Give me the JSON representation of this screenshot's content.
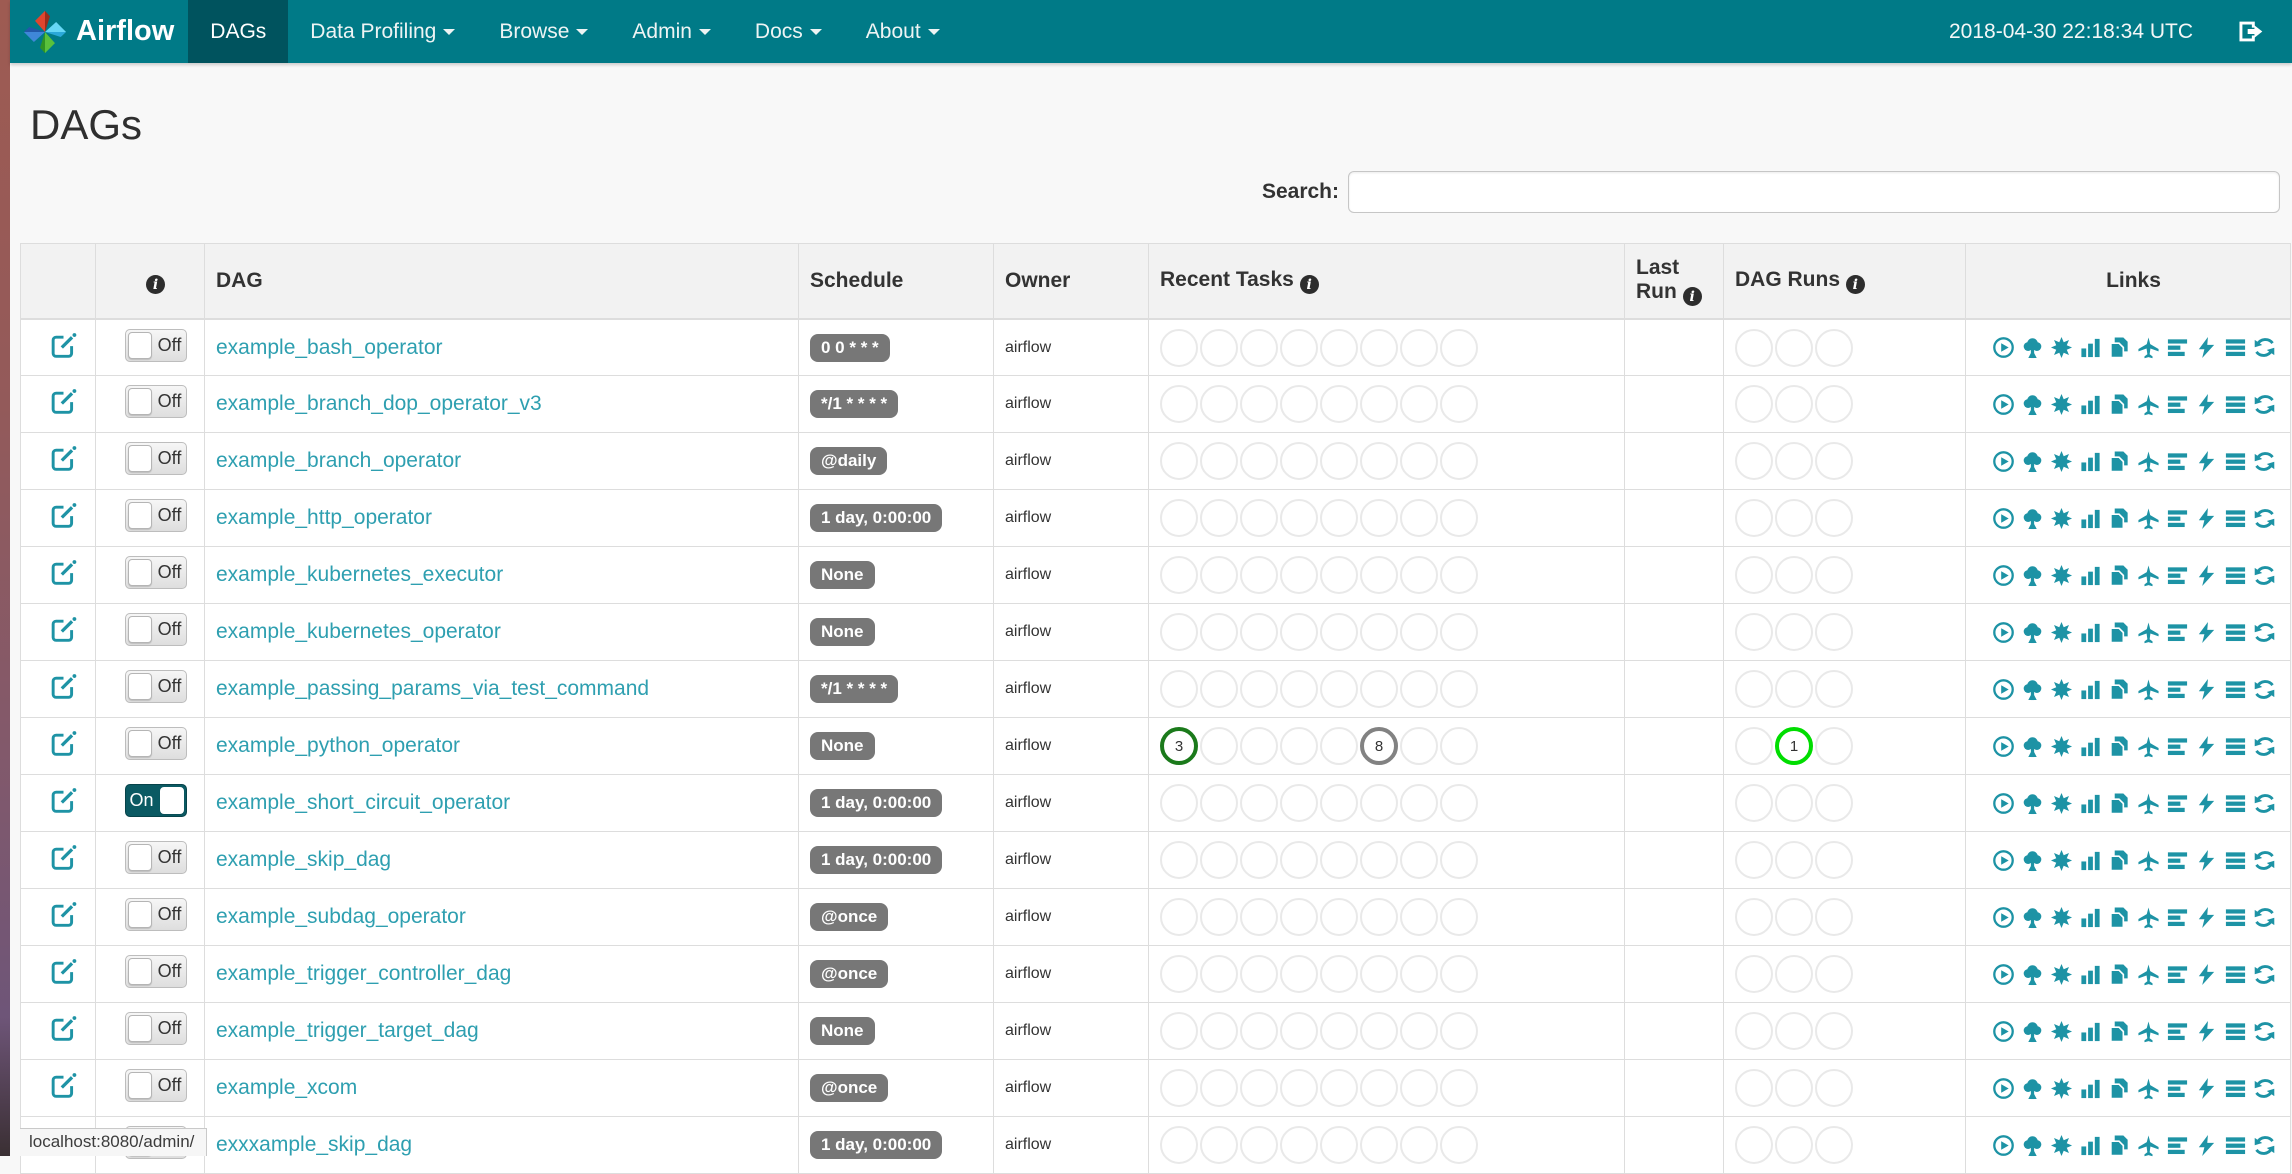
{
  "colors": {
    "navbar": "#007a87",
    "navbar_active": "#00535e",
    "link_teal": "#2e9fb0",
    "icon_teal": "#1d93a5",
    "badge_gray": "#777777",
    "ring_success_green": "#1b7a1b",
    "ring_gray": "#828282",
    "ring_running_lime": "#00dd00"
  },
  "navbar": {
    "brand": "Airflow",
    "clock": "2018-04-30 22:18:34 UTC",
    "items": [
      {
        "label": "DAGs",
        "active": true,
        "caret": false
      },
      {
        "label": "Data Profiling",
        "active": false,
        "caret": true
      },
      {
        "label": "Browse",
        "active": false,
        "caret": true
      },
      {
        "label": "Admin",
        "active": false,
        "caret": true
      },
      {
        "label": "Docs",
        "active": false,
        "caret": true
      },
      {
        "label": "About",
        "active": false,
        "caret": true
      }
    ]
  },
  "page": {
    "title": "DAGs",
    "search_label": "Search:",
    "status_bar": "localhost:8080/admin/"
  },
  "table": {
    "headers": {
      "dag": "DAG",
      "schedule": "Schedule",
      "owner": "Owner",
      "recent_tasks": "Recent Tasks",
      "last_run": "Last Run",
      "dag_runs": "DAG Runs",
      "links": "Links"
    },
    "toggle_on": "On",
    "toggle_off": "Off",
    "recent_tasks_slots": 8,
    "dag_runs_slots": 3,
    "links_icons": [
      "trigger-dag",
      "tree-view",
      "graph-view",
      "task-duration",
      "task-tries",
      "landing-times",
      "gantt-view",
      "code-view",
      "log-view",
      "refresh"
    ],
    "rows": [
      {
        "name": "example_bash_operator",
        "schedule": "0 0 * * *",
        "owner": "airflow",
        "paused": true,
        "recent_tasks": [],
        "dag_runs": [],
        "last_run": ""
      },
      {
        "name": "example_branch_dop_operator_v3",
        "schedule": "*/1 * * * *",
        "owner": "airflow",
        "paused": true,
        "recent_tasks": [],
        "dag_runs": [],
        "last_run": ""
      },
      {
        "name": "example_branch_operator",
        "schedule": "@daily",
        "owner": "airflow",
        "paused": true,
        "recent_tasks": [],
        "dag_runs": [],
        "last_run": ""
      },
      {
        "name": "example_http_operator",
        "schedule": "1 day, 0:00:00",
        "owner": "airflow",
        "paused": true,
        "recent_tasks": [],
        "dag_runs": [],
        "last_run": ""
      },
      {
        "name": "example_kubernetes_executor",
        "schedule": "None",
        "owner": "airflow",
        "paused": true,
        "recent_tasks": [],
        "dag_runs": [],
        "last_run": ""
      },
      {
        "name": "example_kubernetes_operator",
        "schedule": "None",
        "owner": "airflow",
        "paused": true,
        "recent_tasks": [],
        "dag_runs": [],
        "last_run": ""
      },
      {
        "name": "example_passing_params_via_test_command",
        "schedule": "*/1 * * * *",
        "owner": "airflow",
        "paused": true,
        "recent_tasks": [],
        "dag_runs": [],
        "last_run": ""
      },
      {
        "name": "example_python_operator",
        "schedule": "None",
        "owner": "airflow",
        "paused": true,
        "recent_tasks": [
          {
            "slot": 1,
            "count": "3",
            "color": "#1b7a1b"
          },
          {
            "slot": 6,
            "count": "8",
            "color": "#828282"
          }
        ],
        "dag_runs": [
          {
            "slot": 2,
            "count": "1",
            "color": "#00dd00"
          }
        ],
        "last_run": ""
      },
      {
        "name": "example_short_circuit_operator",
        "schedule": "1 day, 0:00:00",
        "owner": "airflow",
        "paused": false,
        "recent_tasks": [],
        "dag_runs": [],
        "last_run": ""
      },
      {
        "name": "example_skip_dag",
        "schedule": "1 day, 0:00:00",
        "owner": "airflow",
        "paused": true,
        "recent_tasks": [],
        "dag_runs": [],
        "last_run": ""
      },
      {
        "name": "example_subdag_operator",
        "schedule": "@once",
        "owner": "airflow",
        "paused": true,
        "recent_tasks": [],
        "dag_runs": [],
        "last_run": ""
      },
      {
        "name": "example_trigger_controller_dag",
        "schedule": "@once",
        "owner": "airflow",
        "paused": true,
        "recent_tasks": [],
        "dag_runs": [],
        "last_run": ""
      },
      {
        "name": "example_trigger_target_dag",
        "schedule": "None",
        "owner": "airflow",
        "paused": true,
        "recent_tasks": [],
        "dag_runs": [],
        "last_run": ""
      },
      {
        "name": "example_xcom",
        "schedule": "@once",
        "owner": "airflow",
        "paused": true,
        "recent_tasks": [],
        "dag_runs": [],
        "last_run": ""
      },
      {
        "name": "exxxample_skip_dag",
        "schedule": "1 day, 0:00:00",
        "owner": "airflow",
        "paused": true,
        "recent_tasks": [],
        "dag_runs": [],
        "last_run": ""
      }
    ]
  }
}
